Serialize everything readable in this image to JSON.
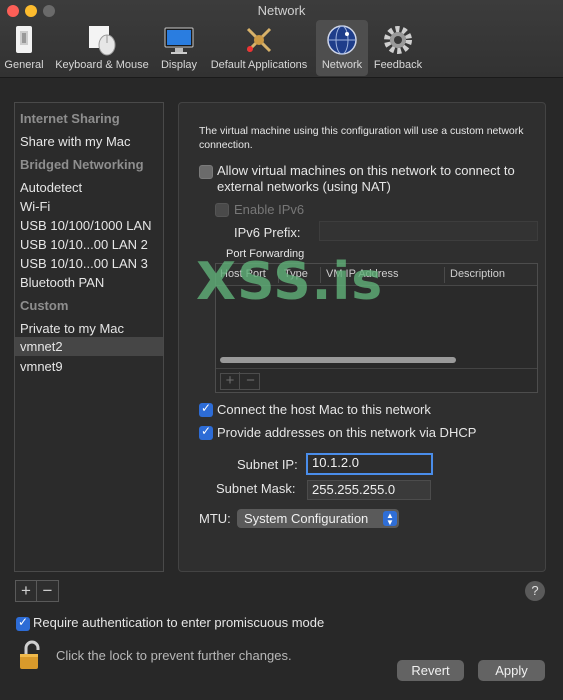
{
  "window": {
    "title": "Network"
  },
  "toolbar": {
    "items": [
      {
        "label": "General",
        "icon": "general-icon"
      },
      {
        "label": "Keyboard & Mouse",
        "icon": "keyboard-mouse-icon"
      },
      {
        "label": "Display",
        "icon": "display-icon"
      },
      {
        "label": "Default Applications",
        "icon": "default-applications-icon"
      },
      {
        "label": "Network",
        "icon": "network-globe-icon",
        "selected": true
      },
      {
        "label": "Feedback",
        "icon": "gear-icon"
      }
    ]
  },
  "sidebar": {
    "groups": [
      {
        "header": "Internet Sharing",
        "items": [
          "Share with my Mac"
        ]
      },
      {
        "header": "Bridged Networking",
        "items": [
          "Autodetect",
          "Wi-Fi",
          "USB 10/100/1000 LAN",
          "USB 10/10...00 LAN 2",
          "USB 10/10...00 LAN 3",
          "Bluetooth PAN"
        ]
      },
      {
        "header": "Custom",
        "items": [
          "Private to my Mac",
          "vmnet2",
          "vmnet9"
        ]
      }
    ],
    "selected": "vmnet2",
    "add_label": "+",
    "remove_label": "−"
  },
  "panel": {
    "description": "The virtual machine using this configuration will use a custom network connection.",
    "nat_label": "Allow virtual machines on this network to connect to external networks (using NAT)",
    "nat_checked": false,
    "ipv6_label": "Enable IPv6",
    "ipv6_prefix_label": "IPv6 Prefix:",
    "ipv6_prefix_value": "",
    "port_forwarding": {
      "title": "Port Forwarding",
      "columns": [
        "Host Port",
        "Type",
        "VM IP Address",
        "Description"
      ],
      "rows": [],
      "add_label": "+",
      "remove_label": "−"
    },
    "connect_host_label": "Connect the host Mac to this network",
    "connect_host_checked": true,
    "dhcp_label": "Provide addresses on this network via DHCP",
    "dhcp_checked": true,
    "subnet_ip_label": "Subnet IP:",
    "subnet_ip_value": "10.1.2.0",
    "subnet_mask_label": "Subnet Mask:",
    "subnet_mask_value": "255.255.255.0",
    "mtu_label": "MTU:",
    "mtu_value": "System Configuration"
  },
  "watermark": "XSS.is",
  "footer": {
    "promiscuous_label": "Require authentication to enter promiscuous mode",
    "promiscuous_checked": true,
    "lock_text": "Click the lock to prevent further changes.",
    "help_label": "?",
    "revert_label": "Revert",
    "apply_label": "Apply"
  },
  "colors": {
    "accent": "#2d6cd6",
    "focus_ring": "#4a8dea",
    "watermark": "#5faf78"
  }
}
